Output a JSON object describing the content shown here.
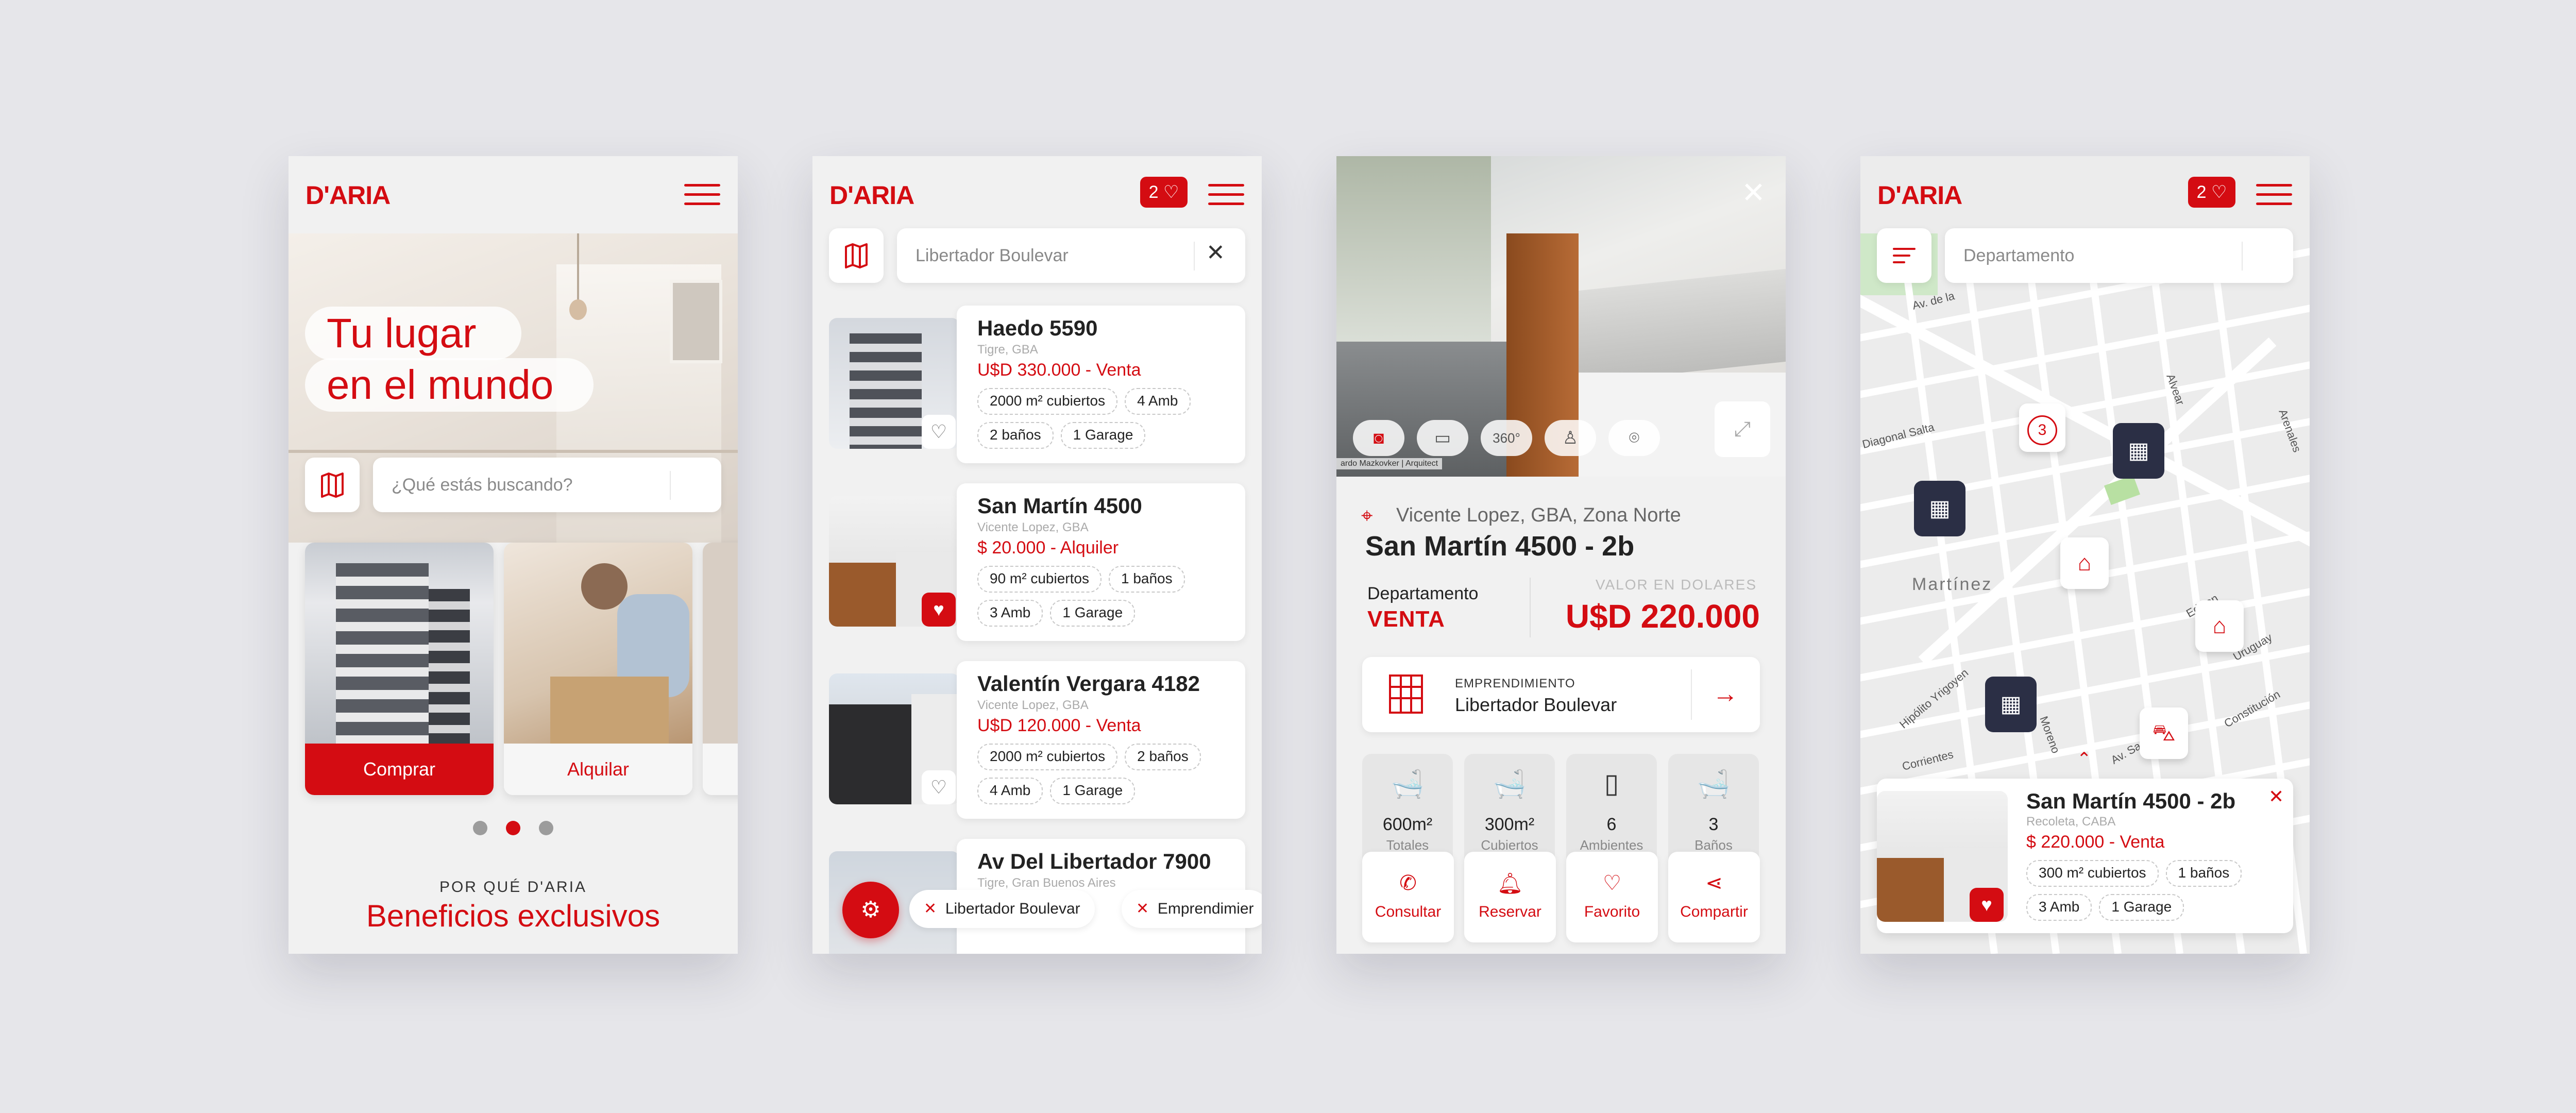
{
  "brand": {
    "logo": "D'ARIA",
    "accent": "#d40c12",
    "dark_marker": "#2b2f45"
  },
  "home": {
    "hero_line1": "Tu lugar",
    "hero_line2": "en el mundo",
    "search_placeholder": "¿Qué estás buscando?",
    "buy_label": "Comprar",
    "rent_label": "Alquilar",
    "carousel": {
      "page": 2,
      "total": 3
    },
    "section_eyebrow": "POR QUÉ D'ARIA",
    "section_title": "Beneficios exclusivos"
  },
  "listing": {
    "favorites_count": "2",
    "search_value": "Libertador Boulevar",
    "cards": [
      {
        "title": "Haedo 5590",
        "location": "Tigre, GBA",
        "price": "U$D 330.000 - Venta",
        "tags": [
          "2000 m² cubiertos",
          "4 Amb",
          "2 baños",
          "1 Garage"
        ],
        "favorite": false
      },
      {
        "title": "San Martín 4500",
        "location": "Vicente Lopez, GBA",
        "price": "$ 20.000 - Alquiler",
        "tags": [
          "90 m² cubiertos",
          "1 baños",
          "3 Amb",
          "1 Garage"
        ],
        "favorite": true
      },
      {
        "title": "Valentín Vergara 4182",
        "location": "Vicente Lopez, GBA",
        "price": "U$D 120.000 - Venta",
        "tags": [
          "2000 m² cubiertos",
          "2 baños",
          "4 Amb",
          "1 Garage"
        ],
        "favorite": false
      },
      {
        "title": "Av Del Libertador 7900",
        "location": "Tigre, Gran Buenos Aires"
      }
    ],
    "filter_chips": [
      "Libertador Boulevar",
      "Emprendimier"
    ]
  },
  "detail": {
    "photo_credit": "ardo Mazkovker | Arquitect",
    "media_icons": [
      "camera-icon",
      "video-icon",
      "360-icon",
      "lamp-icon",
      "location-icon"
    ],
    "location": "Vicente Lopez, GBA, Zona Norte",
    "title": "San Martín 4500 - 2b",
    "type": "Departamento",
    "operation": "VENTA",
    "price_caption": "VALOR EN DOLARES",
    "price": "U$D 220.000",
    "project_caption": "EMPRENDIMIENTO",
    "project_name": "Libertador Boulevar",
    "facts": [
      {
        "icon": "tub-icon",
        "value": "600m²",
        "label": "Totales"
      },
      {
        "icon": "tub-icon",
        "value": "300m²",
        "label": "Cubiertos"
      },
      {
        "icon": "door-icon",
        "value": "6",
        "label": "Ambientes"
      },
      {
        "icon": "tub-icon",
        "value": "3",
        "label": "Baños"
      }
    ],
    "actions": [
      {
        "icon": "phone-icon",
        "label": "Consultar"
      },
      {
        "icon": "bell-icon",
        "label": "Reservar"
      },
      {
        "icon": "heart-icon",
        "label": "Favorito"
      },
      {
        "icon": "share-icon",
        "label": "Compartir"
      }
    ]
  },
  "map": {
    "favorites_count": "2",
    "search_placeholder": "Departamento",
    "area_label": "Martínez",
    "streets": [
      "Av. de la",
      "Diagonal Salta",
      "Hipólito Yrigoyen",
      "Corrientes",
      "Uruguay",
      "Alvear",
      "Arenales",
      "Av. Santa Fe",
      "Moreno",
      "Edison",
      "Constitución"
    ],
    "cluster_count": "3",
    "card": {
      "title": "San Martín 4500 - 2b",
      "location": "Recoleta, CABA",
      "price": "$ 220.000 - Venta",
      "tags": [
        "300 m² cubiertos",
        "1 baños",
        "3 Amb",
        "1 Garage"
      ],
      "favorite": true
    }
  }
}
